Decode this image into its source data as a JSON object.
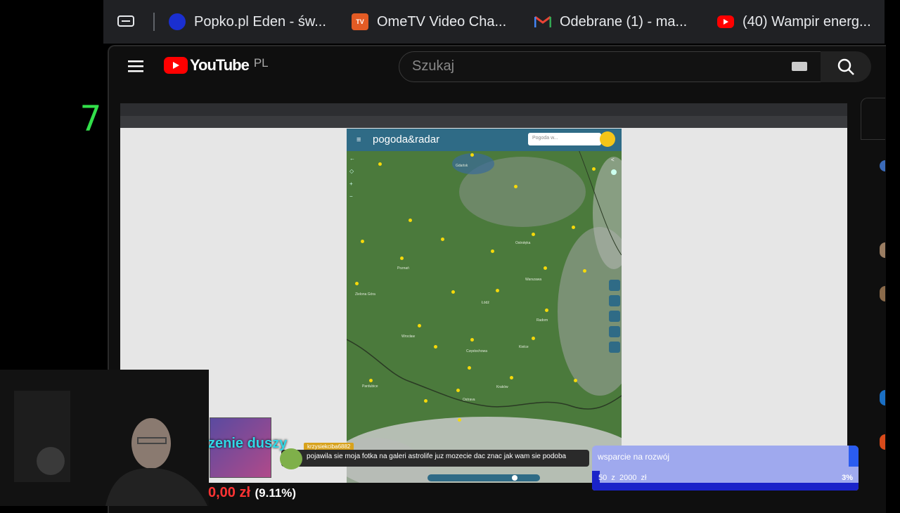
{
  "browser": {
    "tabs": [
      {
        "label": "Popko.pl Eden - św...",
        "icon": "popko-icon",
        "color": "#1a2fd0"
      },
      {
        "label": "OmeTV Video Cha...",
        "icon": "ometv-icon",
        "color": "#e35b24"
      },
      {
        "label": "Odebrane (1) - ma...",
        "icon": "gmail-icon",
        "color": "#ea4335"
      },
      {
        "label": "(40) Wampir energ...",
        "icon": "youtube-icon",
        "color": "#ff0000"
      }
    ]
  },
  "youtube": {
    "logo_text": "YouTube",
    "region": "PL",
    "search_placeholder": "Szukaj"
  },
  "side_counter": "7",
  "pogoda": {
    "logo": "pogoda&radar",
    "search_placeholder": "Pogoda w..."
  },
  "overlay": {
    "stream_title": "zenie duszy",
    "chat_user": "krzysiekciba6882",
    "chat_message": "pojawila sie moja fotka na galeri astrolife juz mozecie dac znac jak wam sie podoba",
    "donation_amount": "0,00 zł",
    "donation_percent": "(9.11%)",
    "goal_title": "wsparcie na rozwój",
    "goal_progress_text": "50  z  2000  zł",
    "goal_percent": "3%",
    "goal_fraction": 0.03
  },
  "colors": {
    "accent_red": "#ff0000",
    "counter_green": "#32e04a",
    "goal_bar": "#1a23c9",
    "title_cyan": "#30d8e6"
  }
}
